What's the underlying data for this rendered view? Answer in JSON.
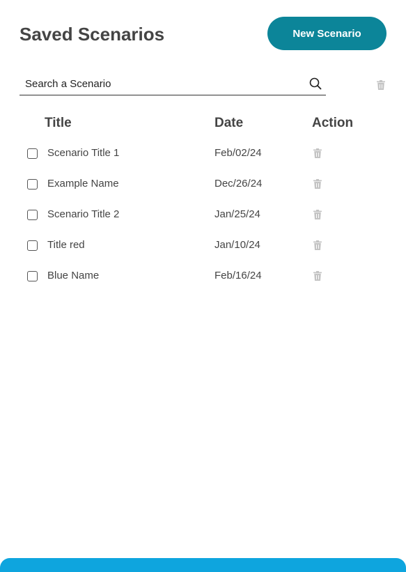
{
  "header": {
    "title": "Saved Scenarios",
    "new_button_label": "New Scenario"
  },
  "search": {
    "placeholder": "Search a Scenario",
    "value": ""
  },
  "table": {
    "columns": [
      "Title",
      "Date",
      "Action"
    ],
    "rows": [
      {
        "title": "Scenario Title 1",
        "date": "Feb/02/24",
        "checked": false
      },
      {
        "title": "Example Name",
        "date": "Dec/26/24",
        "checked": false
      },
      {
        "title": "Scenario Title 2",
        "date": "Jan/25/24",
        "checked": false
      },
      {
        "title": "Title red",
        "date": "Jan/10/24",
        "checked": false
      },
      {
        "title": "Blue Name",
        "date": "Feb/16/24",
        "checked": false
      }
    ]
  },
  "colors": {
    "primary_button": "#0c8599",
    "bottom_bar": "#0ea5de",
    "trash_icon": "#c4c4c4",
    "text": "#444444"
  },
  "icons": {
    "search": "search-icon",
    "delete": "trash-icon",
    "select": "checkbox"
  }
}
